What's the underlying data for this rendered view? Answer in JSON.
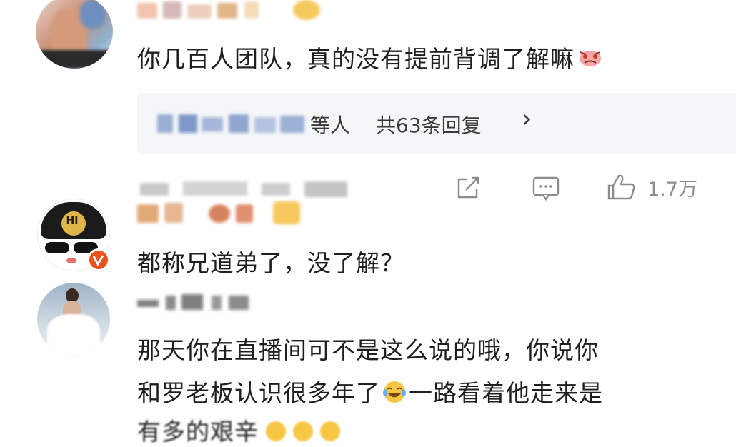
{
  "comment1": {
    "text": "你几百人团队，真的没有提前背调了解嘛",
    "replies": {
      "suffix": "等人",
      "count_text": "共63条回复",
      "chevron": "›"
    },
    "actions": {
      "share_icon": "share-icon",
      "comment_icon": "comment-icon",
      "like_icon": "like-icon",
      "like_count": "1.7万"
    }
  },
  "comment2": {
    "text": "都称兄道弟了，没了解？"
  },
  "comment3": {
    "line1": "那天你在直播间可不是这么说的哦，你说你",
    "line2_a": "和罗老板认识很多年了",
    "line2_b": "一路看着他走来是",
    "line3": "有多的艰辛"
  },
  "colors": {
    "text": "#1f1f1f",
    "gray": "#9a9a9a",
    "reply_bg": "#f4f6f8",
    "verified": "#e8541e"
  }
}
